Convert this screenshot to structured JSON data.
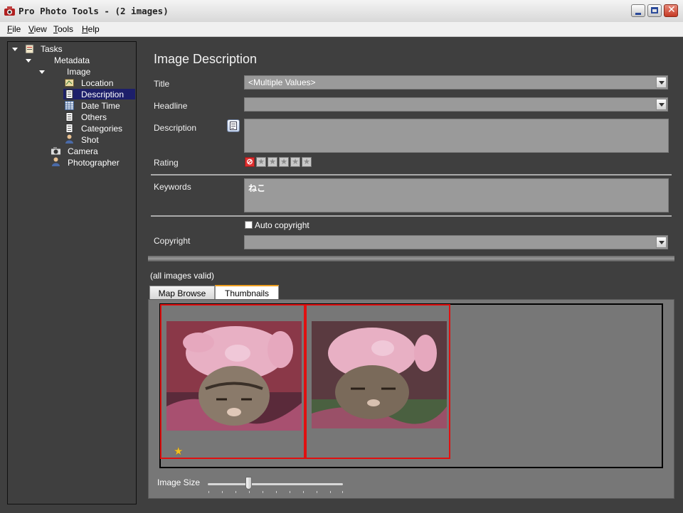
{
  "window": {
    "title": "Pro Photo Tools - (2 images)"
  },
  "menu": [
    "File",
    "View",
    "Tools",
    "Help"
  ],
  "tree": {
    "root": "Tasks",
    "metadata": "Metadata",
    "image": "Image",
    "image_children": [
      "Location",
      "Description",
      "Date Time",
      "Others",
      "Categories",
      "Shot"
    ],
    "camera": "Camera",
    "photographer": "Photographer",
    "selected": "Description"
  },
  "panel": {
    "heading": "Image Description",
    "title_label": "Title",
    "title_value": "<Multiple Values>",
    "headline_label": "Headline",
    "headline_value": "",
    "description_label": "Description",
    "description_value": "",
    "rating_label": "Rating",
    "rating_value": 0,
    "keywords_label": "Keywords",
    "keywords_value": "ねこ",
    "auto_copyright_label": "Auto copyright",
    "auto_copyright_checked": false,
    "copyright_label": "Copyright",
    "copyright_value": ""
  },
  "status_text": "(all images valid)",
  "tabs": [
    "Map Browse",
    "Thumbnails"
  ],
  "active_tab": "Thumbnails",
  "thumbnails": [
    {
      "name": "cat-in-pig-hat-1",
      "starred": true
    },
    {
      "name": "cat-in-pig-hat-2",
      "starred": false
    }
  ],
  "image_size_label": "Image Size",
  "image_size_level": 0.3,
  "colors": {
    "selection": "#1d1f6a",
    "thumb_border": "#e01010",
    "background": "#3f3f3f"
  }
}
